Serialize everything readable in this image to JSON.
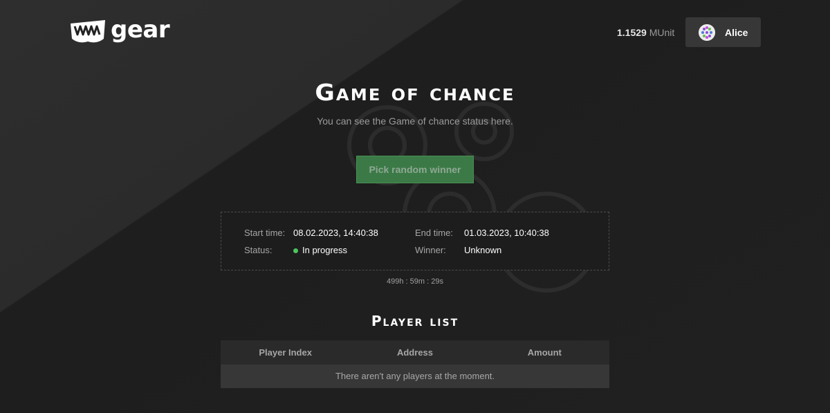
{
  "header": {
    "logo_text": "gear",
    "balance": {
      "value": "1.1529",
      "unit": "MUnit"
    },
    "account": {
      "name": "Alice"
    }
  },
  "game": {
    "title": "Game of chance",
    "subtitle": "You can see the Game of chance status here.",
    "pick_button_label": "Pick random winner",
    "start_time_label": "Start time:",
    "start_time_value": "08.02.2023, 14:40:38",
    "end_time_label": "End time:",
    "end_time_value": "01.03.2023, 10:40:38",
    "status_label": "Status:",
    "status_value": "In progress",
    "winner_label": "Winner:",
    "winner_value": "Unknown",
    "timer": "499h : 59m : 29s"
  },
  "players": {
    "title": "Player list",
    "columns": [
      "Player Index",
      "Address",
      "Amount"
    ],
    "empty_message": "There aren't any players at the moment."
  },
  "colors": {
    "background": "#232323",
    "accent_green": "#3b7a46",
    "status_green": "#4cc55f",
    "account_button": "#373737"
  }
}
